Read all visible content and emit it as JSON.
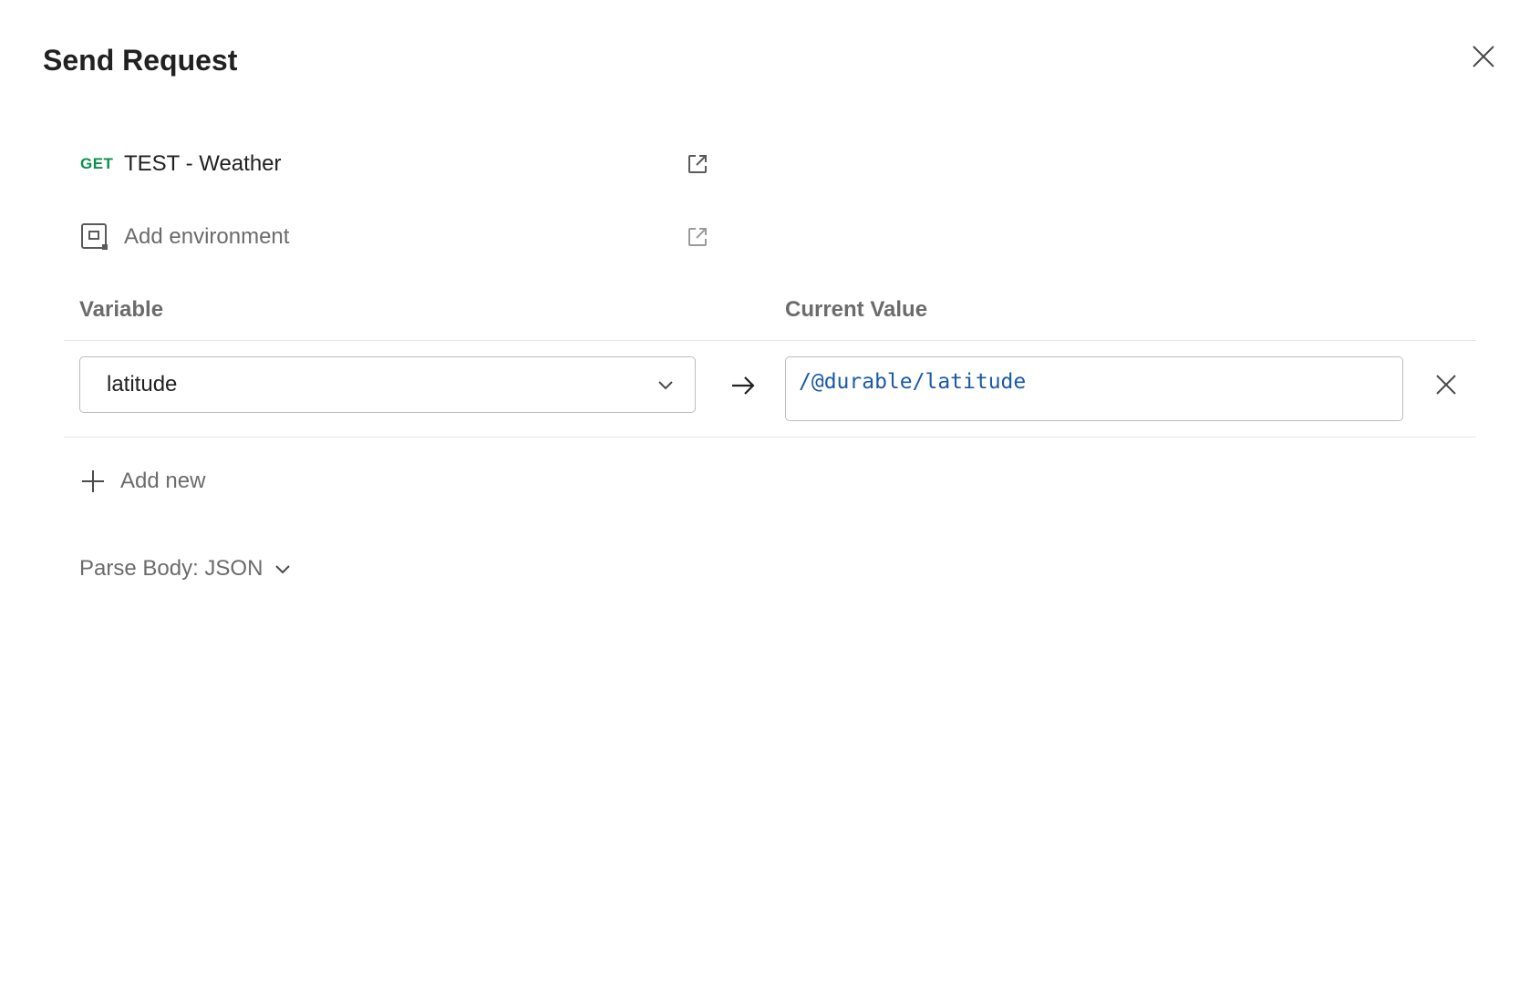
{
  "modal": {
    "title": "Send Request"
  },
  "request": {
    "method": "GET",
    "name": "TEST - Weather"
  },
  "environment": {
    "label": "Add environment"
  },
  "table": {
    "columns": {
      "variable": "Variable",
      "current_value": "Current Value"
    },
    "rows": [
      {
        "variable": "latitude",
        "current_value": "/@durable/latitude"
      }
    ]
  },
  "actions": {
    "add_new": "Add new"
  },
  "parse_body": {
    "label": "Parse Body: JSON"
  },
  "icons": {
    "close": "close-icon",
    "external_link": "external-link-icon",
    "environment": "environment-icon",
    "chevron_down": "chevron-down-icon",
    "arrow_right": "arrow-right-icon",
    "remove": "remove-icon",
    "plus": "plus-icon"
  },
  "colors": {
    "method_get": "#0c8f4f",
    "value_text": "#1b5aa5",
    "muted_text": "#6b6b6b"
  }
}
